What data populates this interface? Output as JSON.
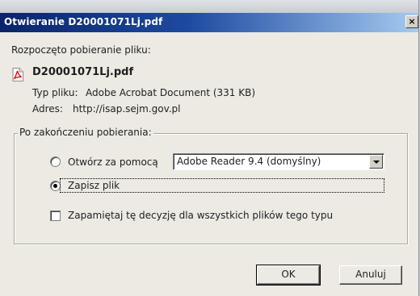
{
  "dialog": {
    "title": "Otwieranie D20001071Lj.pdf",
    "close_label": "×",
    "intro_text": "Rozpoczęto pobieranie pliku:",
    "filename": "D20001071Lj.pdf",
    "file_type_label": "Typ pliku:",
    "file_type_value": "Adobe Acrobat Document (331  KB)",
    "address_label": "Adres:",
    "address_value": "http://isap.sejm.gov.pl"
  },
  "after_download": {
    "group_label": "Po zakończeniu pobierania:",
    "open_with_label": "Otwórz za pomocą",
    "open_with_selected": false,
    "open_with_app": "Adobe Reader 9.4 (domyślny)",
    "save_file_label": "Zapisz plik",
    "save_file_selected": true,
    "remember_label": "Zapamiętaj tę decyzję dla wszystkich plików tego typu",
    "remember_checked": false
  },
  "buttons": {
    "ok_label": "OK",
    "cancel_label": "Anuluj"
  },
  "icons": {
    "file_icon": "pdf-file-icon",
    "close_icon": "close-icon"
  }
}
